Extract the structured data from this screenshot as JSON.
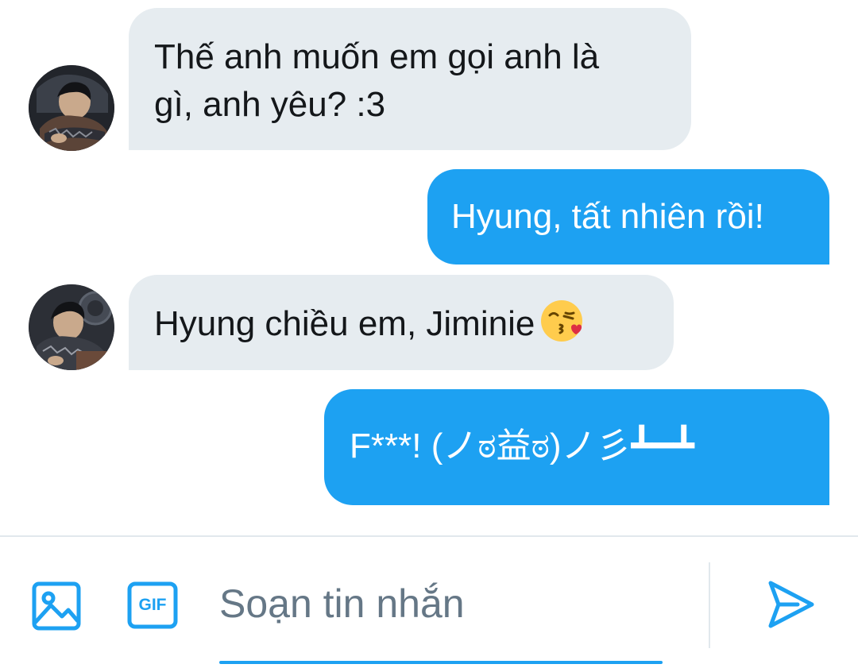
{
  "conversation": {
    "messages": [
      {
        "direction": "incoming",
        "text_line1": "Thế anh muốn em gọi anh là",
        "text_line2": "gì, anh yêu? :3"
      },
      {
        "direction": "outgoing",
        "text": "Hyung, tất nhiên rồi!"
      },
      {
        "direction": "incoming",
        "text": "Hyung chiều em, Jiminie",
        "emoji": "face-blowing-a-kiss"
      },
      {
        "direction": "outgoing",
        "text": "F***! (ノಠ益ಠ)ノ彡┻━┻"
      }
    ]
  },
  "composer": {
    "placeholder": "Soạn tin nhắn",
    "value": "",
    "media_icon": "image-icon",
    "gif_label": "GIF",
    "send_icon": "send-icon"
  },
  "colors": {
    "accent": "#1da1f2",
    "incoming_bubble": "#e6ecf0",
    "text": "#14171a",
    "placeholder": "#657786"
  }
}
